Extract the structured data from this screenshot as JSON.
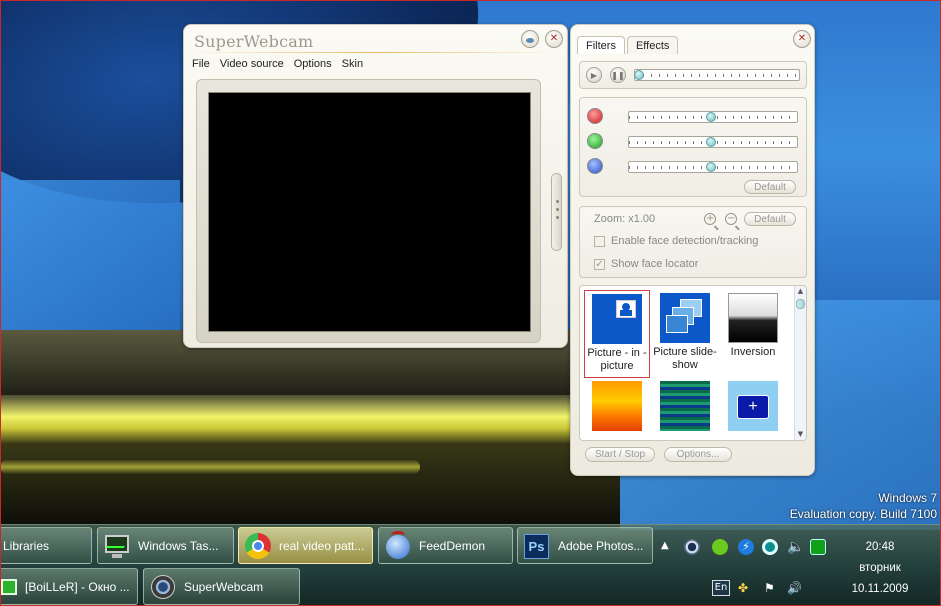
{
  "app": {
    "title": "SuperWebcam",
    "menu": [
      "File",
      "Video source",
      "Options",
      "Skin"
    ]
  },
  "panel": {
    "tabs": [
      "Filters",
      "Effects"
    ],
    "rgb_default_label": "Default",
    "zoom_label": "Zoom: x1.00",
    "zoom_default_label": "Default",
    "face_detection_label": "Enable face detection/tracking",
    "face_locator_label": "Show face locator",
    "face_detection_checked": false,
    "face_locator_checked": true,
    "colors": {
      "red": "#e03030",
      "green": "#30b030",
      "blue": "#3060d0"
    },
    "filters": [
      {
        "label": "Picture - in - picture",
        "icon": "picture-in-picture-icon",
        "selected": true
      },
      {
        "label": "Picture slide-show",
        "icon": "slide-show-icon",
        "selected": false
      },
      {
        "label": "Inversion",
        "icon": "inversion-icon",
        "selected": false
      },
      {
        "label": "",
        "icon": "colorize-icon",
        "selected": false
      },
      {
        "label": "",
        "icon": "filter-icon",
        "selected": false
      },
      {
        "label": "",
        "icon": "sketch-icon",
        "selected": false
      }
    ],
    "start_stop_label": "Start / Stop",
    "options_label": "Options..."
  },
  "desktop": {
    "watermark_line1": "Windows 7",
    "watermark_line2": "Evaluation copy. Build 7100"
  },
  "taskbar": {
    "row1": [
      {
        "label": "Libraries",
        "icon": "folder-icon"
      },
      {
        "label": "Windows Tas...",
        "icon": "task-manager-icon"
      },
      {
        "label": "real video patt...",
        "icon": "chrome-icon",
        "active": true
      },
      {
        "label": "FeedDemon",
        "icon": "feeddemon-icon"
      },
      {
        "label": "Adobe Photos...",
        "icon": "photoshop-icon"
      }
    ],
    "row2": [
      {
        "label": "[BoiLLeR] - Окно ...",
        "icon": "chat-icon"
      },
      {
        "label": "SuperWebcam",
        "icon": "webcam-icon"
      }
    ],
    "language": "En",
    "clock": {
      "time": "20:48",
      "day": "вторник",
      "date": "10.11.2009"
    }
  }
}
